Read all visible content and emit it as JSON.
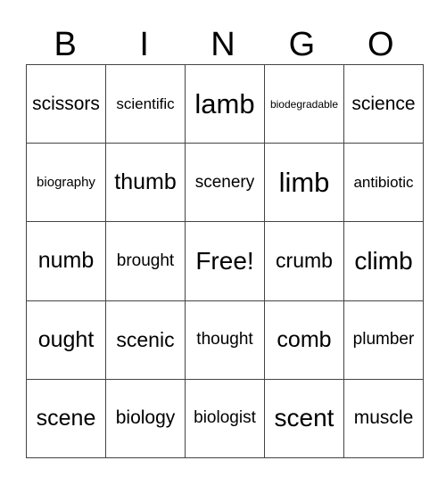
{
  "header": [
    "B",
    "I",
    "N",
    "G",
    "O"
  ],
  "rows": [
    [
      "scissors",
      "scientific",
      "lamb",
      "biodegradable",
      "science"
    ],
    [
      "biography",
      "thumb",
      "scenery",
      "limb",
      "antibiotic"
    ],
    [
      "numb",
      "brought",
      "Free!",
      "crumb",
      "climb"
    ],
    [
      "ought",
      "scenic",
      "thought",
      "comb",
      "plumber"
    ],
    [
      "scene",
      "biology",
      "biologist",
      "scent",
      "muscle"
    ]
  ]
}
